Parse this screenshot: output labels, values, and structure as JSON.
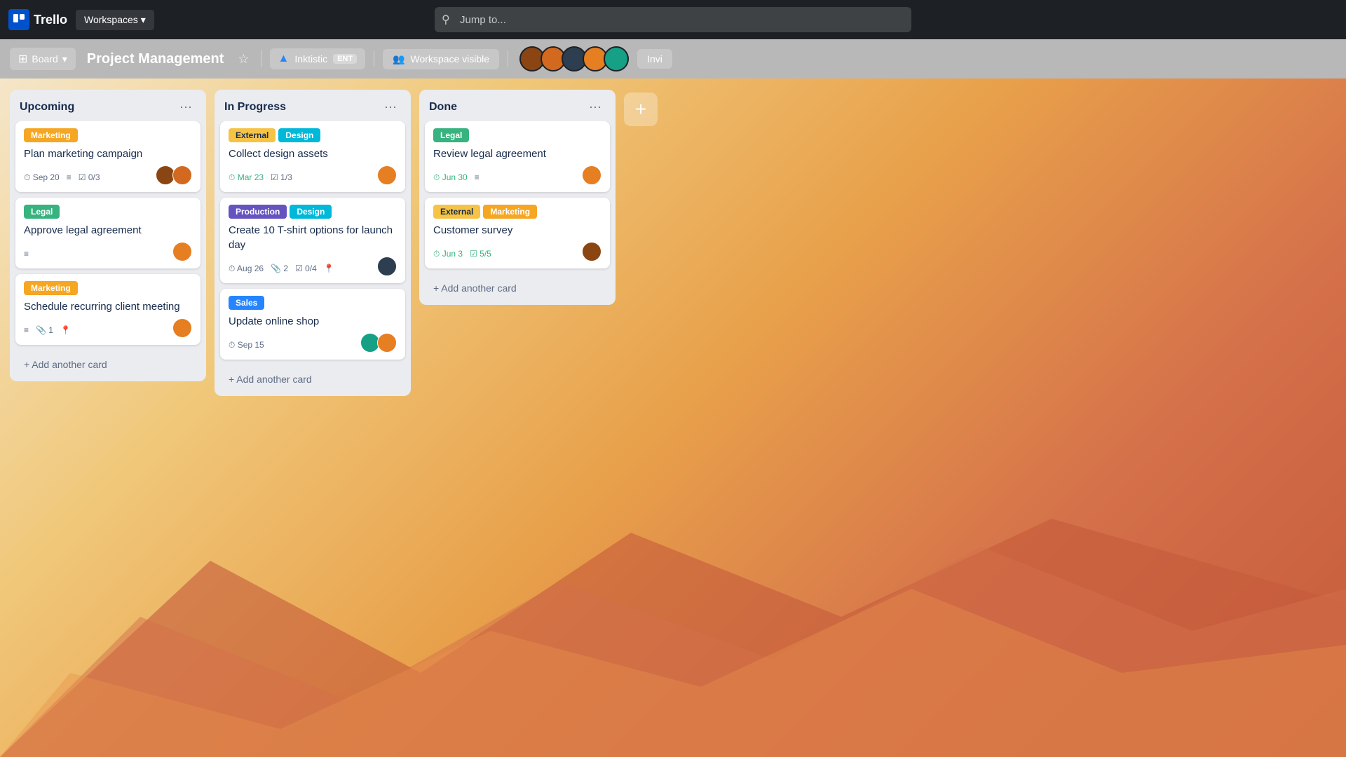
{
  "nav": {
    "logo_text": "Trello",
    "workspaces_label": "Workspaces",
    "search_placeholder": "Jump to..."
  },
  "toolbar": {
    "board_label": "Board",
    "board_title": "Project Management",
    "star_title": "Star board",
    "workspace_name": "Inktistic",
    "workspace_badge": "ENT",
    "workspace_visible_label": "Workspace visible",
    "invite_label": "Invi"
  },
  "columns": [
    {
      "id": "upcoming",
      "title": "Upcoming",
      "cards": [
        {
          "id": "c1",
          "labels": [
            {
              "text": "Marketing",
              "color": "label-orange"
            }
          ],
          "title": "Plan marketing campaign",
          "date": "Sep 20",
          "has_desc": true,
          "checklist": "0/3",
          "avatars": [
            "av1",
            "av2"
          ]
        },
        {
          "id": "c2",
          "labels": [
            {
              "text": "Legal",
              "color": "label-green"
            }
          ],
          "title": "Approve legal agreement",
          "has_desc": true,
          "avatars": [
            "av4"
          ]
        },
        {
          "id": "c3",
          "labels": [
            {
              "text": "Marketing",
              "color": "label-orange"
            }
          ],
          "title": "Schedule recurring client meeting",
          "has_desc": true,
          "attach": "1",
          "has_loc": true,
          "avatars": [
            "av4"
          ]
        }
      ],
      "add_label": "+ Add another card"
    },
    {
      "id": "inprogress",
      "title": "In Progress",
      "cards": [
        {
          "id": "c4",
          "labels": [
            {
              "text": "External",
              "color": "label-yellow"
            },
            {
              "text": "Design",
              "color": "label-cyan"
            }
          ],
          "title": "Collect design assets",
          "date": "Mar 23",
          "date_green": true,
          "checklist": "1/3",
          "avatars": [
            "av4"
          ]
        },
        {
          "id": "c5",
          "labels": [
            {
              "text": "Production",
              "color": "label-purple"
            },
            {
              "text": "Design",
              "color": "label-cyan"
            }
          ],
          "title": "Create 10 T-shirt options for launch day",
          "date": "Aug 26",
          "attach": "2",
          "checklist": "0/4",
          "has_loc": true,
          "avatars": [
            "av3"
          ]
        },
        {
          "id": "c6",
          "labels": [
            {
              "text": "Sales",
              "color": "label-sales"
            }
          ],
          "title": "Update online shop",
          "date": "Sep 15",
          "avatars": [
            "av5",
            "av4"
          ]
        }
      ],
      "add_label": "+ Add another card"
    },
    {
      "id": "done",
      "title": "Done",
      "cards": [
        {
          "id": "c7",
          "labels": [
            {
              "text": "Legal",
              "color": "label-green"
            }
          ],
          "title": "Review legal agreement",
          "date": "Jun 30",
          "date_green": true,
          "has_desc": true,
          "avatars": [
            "av4"
          ]
        },
        {
          "id": "c8",
          "labels": [
            {
              "text": "External",
              "color": "label-yellow"
            },
            {
              "text": "Marketing",
              "color": "label-orange"
            }
          ],
          "title": "Customer survey",
          "date": "Jun 3",
          "date_green": true,
          "checklist": "5/5",
          "checklist_green": true,
          "avatars": [
            "av1"
          ]
        }
      ],
      "add_label": "+ Add another card"
    }
  ]
}
